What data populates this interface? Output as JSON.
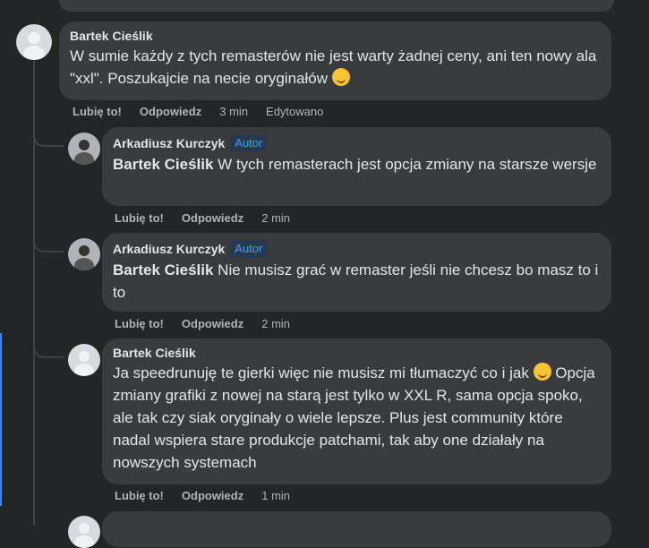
{
  "comments": [
    {
      "author": "Bartek Cieślik",
      "text": "W sumie każdy z tych remasterów nie jest warty żadnej ceny, ani ten nowy ala \"xxl\". Poszukajcie na necie oryginałów",
      "like": "Lubię to!",
      "reply": "Odpowiedz",
      "time": "3 min",
      "edited": "Edytowano"
    }
  ],
  "replies": [
    {
      "author": "Arkadiusz Kurczyk",
      "badge": "Autor",
      "mention": "Bartek Cieślik",
      "text": " W tych remasterach jest opcja zmiany na starsze wersje",
      "like": "Lubię to!",
      "reply": "Odpowiedz",
      "time": "2 min"
    },
    {
      "author": "Arkadiusz Kurczyk",
      "badge": "Autor",
      "mention": "Bartek Cieślik",
      "text": " Nie musisz grać w remaster jeśli nie chcesz bo masz to i to",
      "like": "Lubię to!",
      "reply": "Odpowiedz",
      "time": "2 min"
    },
    {
      "author": "Bartek Cieślik",
      "text_a": "Ja speedrunuję te gierki więc nie musisz mi tłumaczyć co i jak",
      "text_b": " Opcja zmiany grafiki z nowej na starą jest tylko w XXL R, sama opcja spoko, ale tak czy siak oryginały o wiele lepsze. Plus jest community które nadal wspiera stare produkcje patchami, tak aby one działały na nowszych systemach",
      "like": "Lubię to!",
      "reply": "Odpowiedz",
      "time": "1 min"
    }
  ],
  "colors": {
    "background": "#242526",
    "bubble": "#3a3b3c",
    "badge": "#4599ff"
  }
}
